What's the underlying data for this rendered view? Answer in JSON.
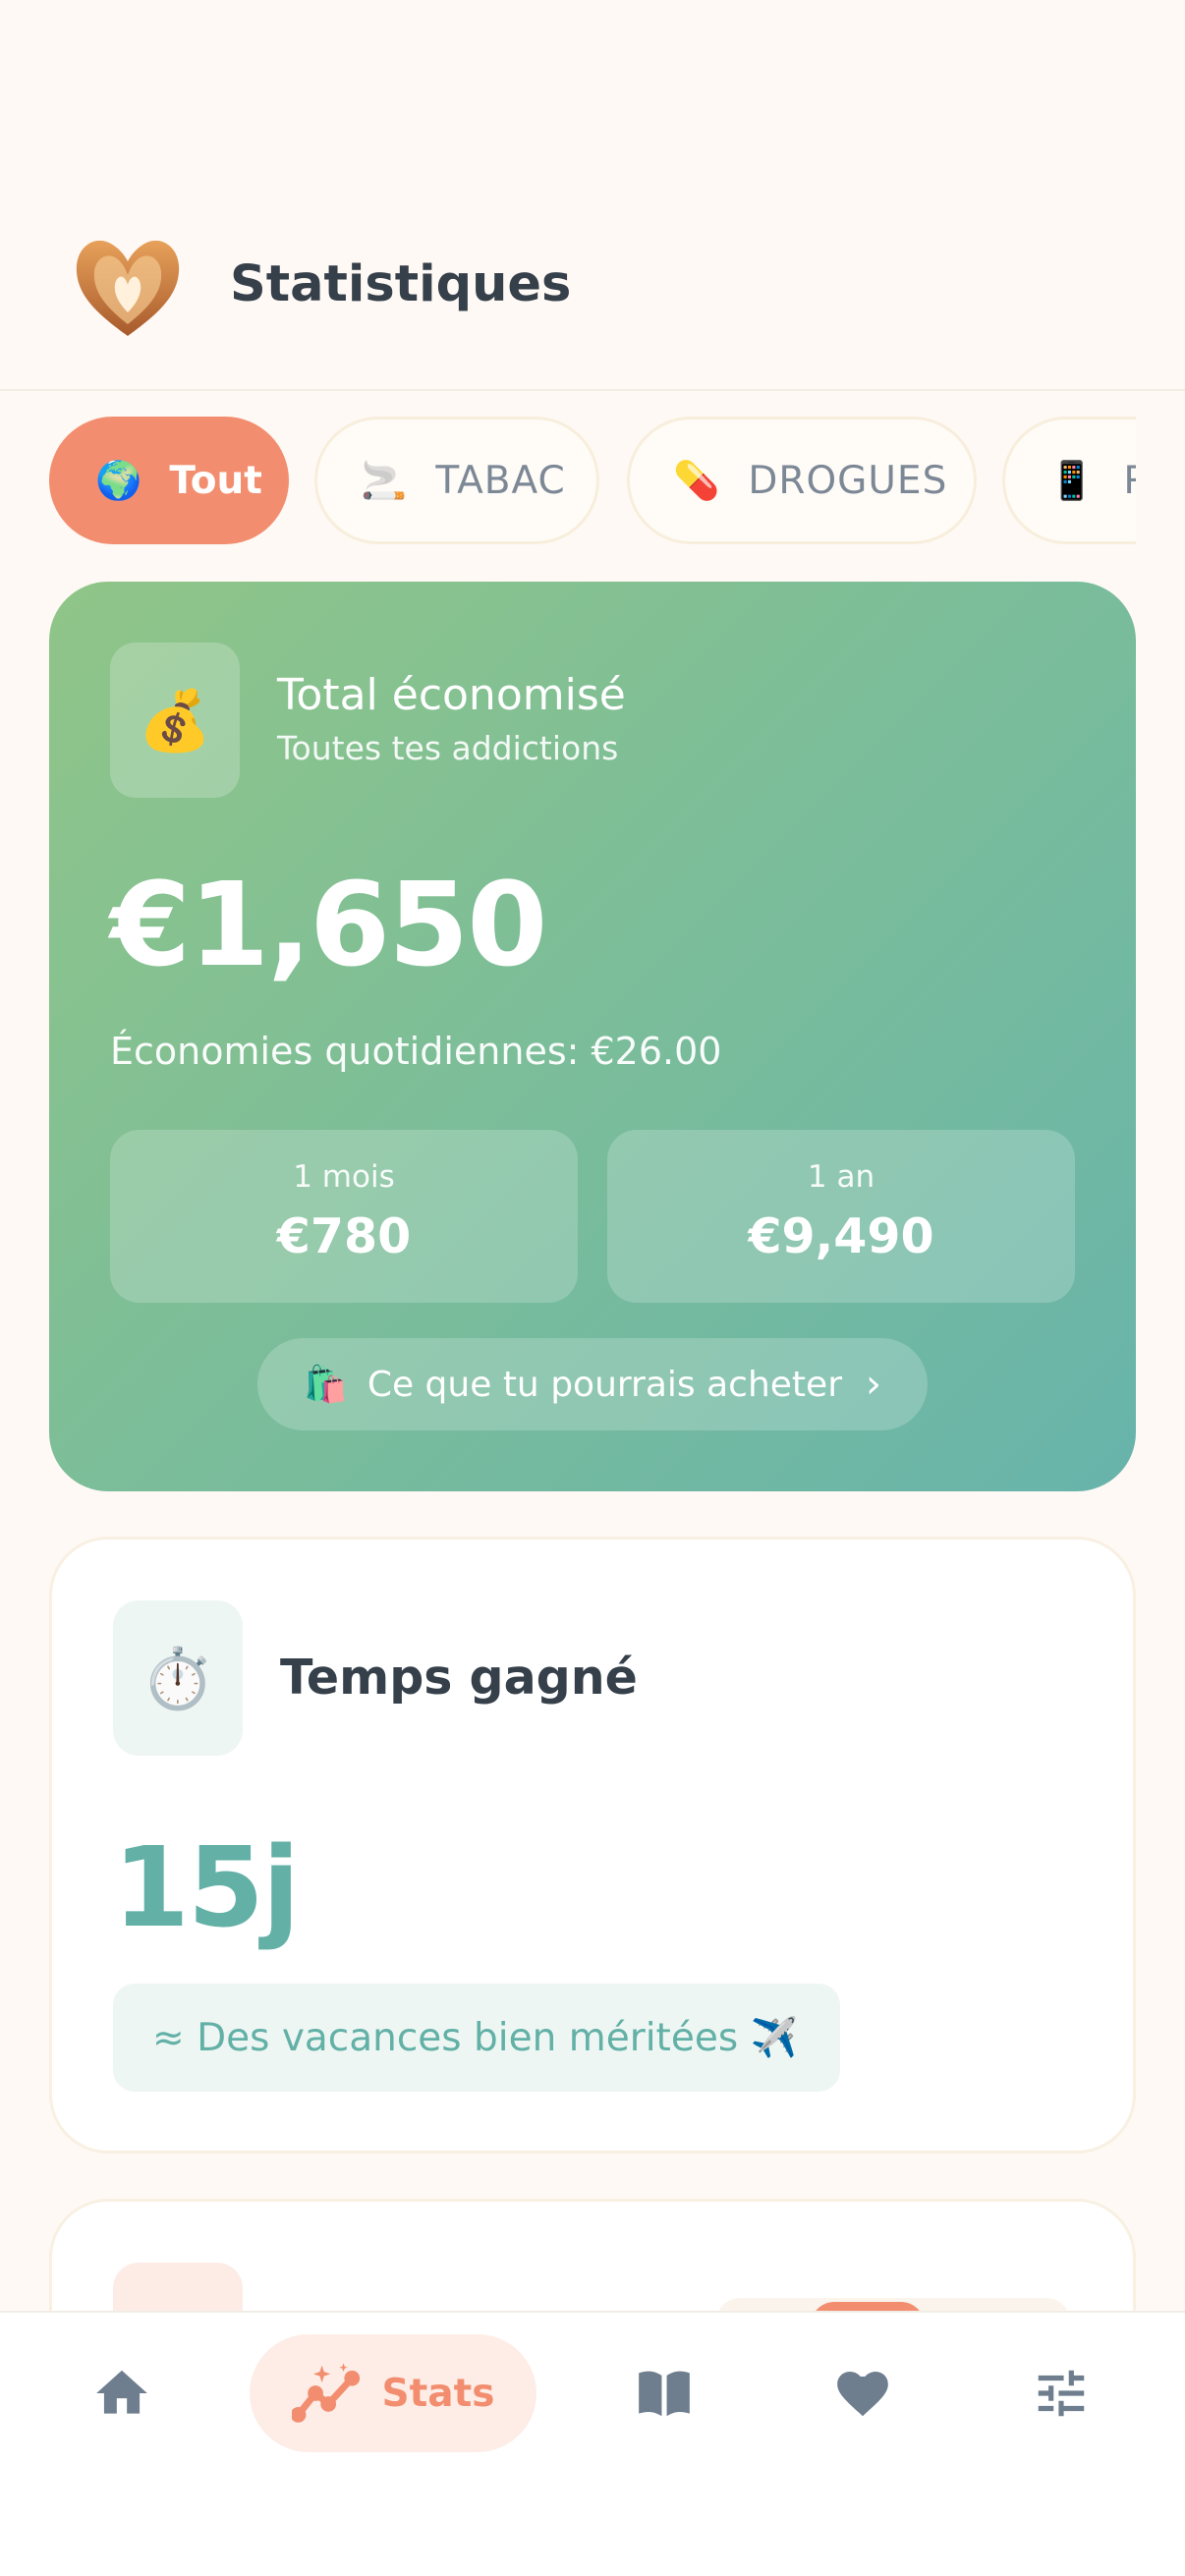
{
  "header": {
    "title": "Statistiques",
    "logo_icon": "flaming-heart-logo"
  },
  "filters": [
    {
      "emoji": "🌍",
      "label": "Tout",
      "active": true
    },
    {
      "emoji": "🚬",
      "label": "TABAC",
      "active": false
    },
    {
      "emoji": "💊",
      "label": "DROGUES",
      "active": false
    },
    {
      "emoji": "📱",
      "label": "R",
      "active": false
    }
  ],
  "savings": {
    "icon": "💰",
    "title": "Total économisé",
    "subtitle": "Toutes tes addictions",
    "amount": "€1,650",
    "daily": "Économies quotidiennes: €26.00",
    "periods": [
      {
        "label": "1 mois",
        "value": "€780"
      },
      {
        "label": "1 an",
        "value": "€9,490"
      }
    ],
    "buy_emoji": "🛍️",
    "buy_label": "Ce que tu pourrais acheter",
    "buy_chevron": "›"
  },
  "time": {
    "icon": "⏱️",
    "title": "Temps gagné",
    "value": "15j",
    "note": "≈ Des vacances bien méritées ✈️"
  },
  "nav": {
    "items": [
      {
        "id": "home",
        "icon": "home-icon"
      },
      {
        "id": "stats",
        "icon": "stats-sparkle-icon",
        "label": "Stats",
        "active": true
      },
      {
        "id": "journal",
        "icon": "book-icon"
      },
      {
        "id": "favorites",
        "icon": "heart-icon"
      },
      {
        "id": "settings",
        "icon": "sliders-icon"
      }
    ]
  },
  "colors": {
    "accent": "#F28E6F",
    "teal": "#62B0A6",
    "background": "#FFF9F5"
  }
}
